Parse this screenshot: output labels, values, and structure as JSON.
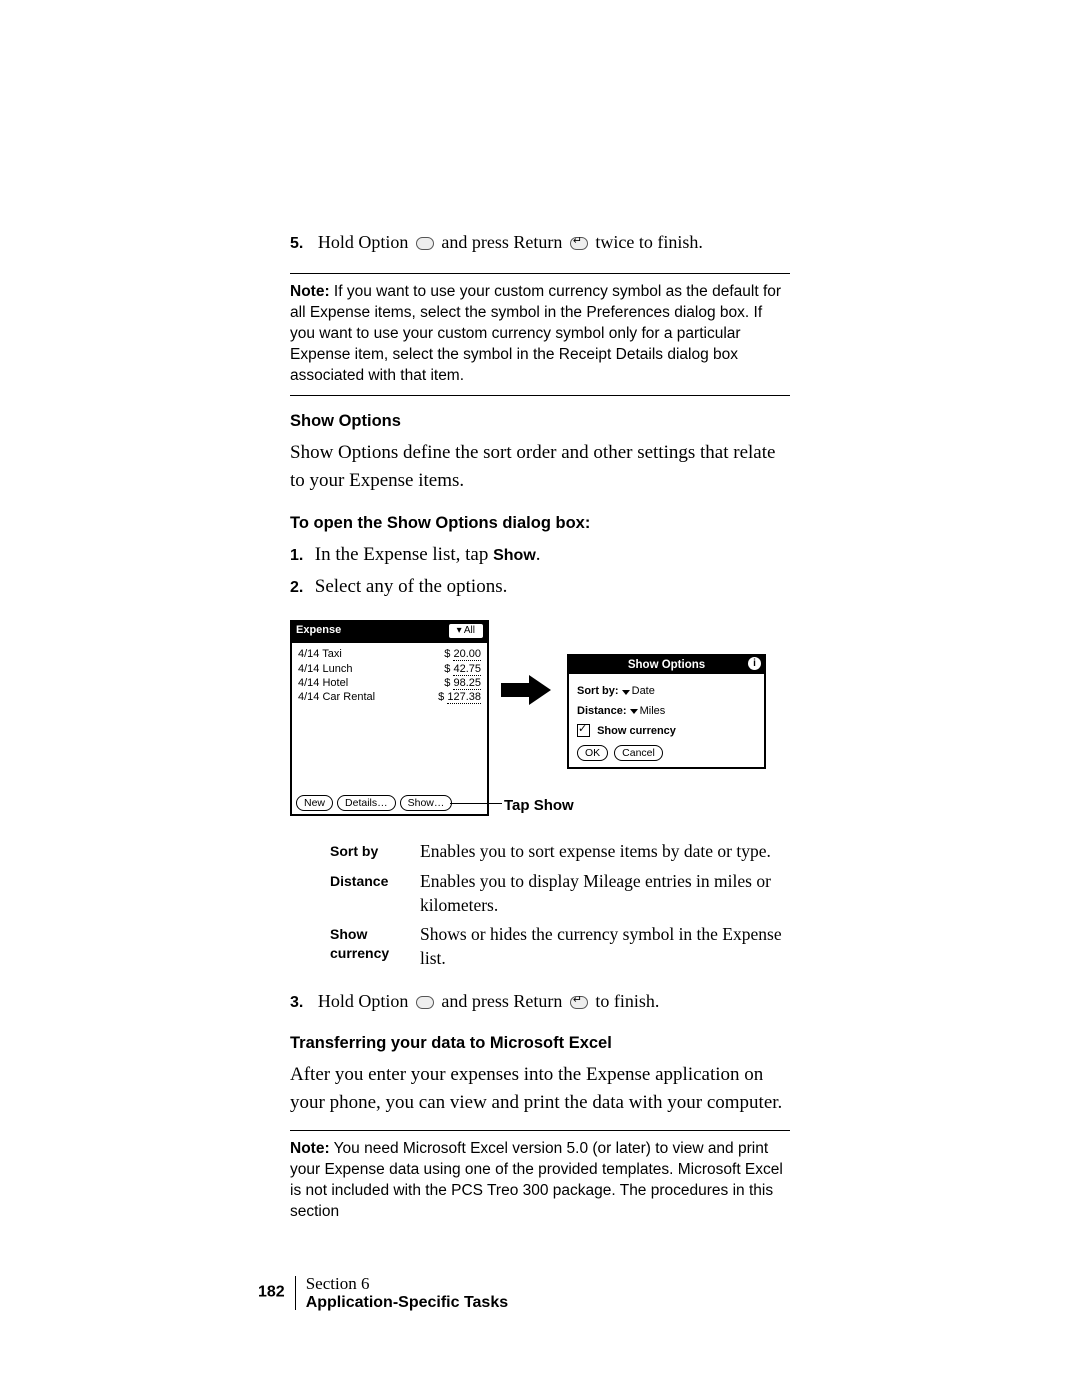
{
  "step5": {
    "num": "5.",
    "pre": "Hold Option ",
    "mid": " and press Return ",
    "post": " twice to finish."
  },
  "note1": {
    "label": "Note:",
    "text": " If you want to use your custom currency symbol as the default for all Expense items, select the symbol in the Preferences dialog box. If you want to use your custom currency symbol only for a particular Expense item, select the symbol in the Receipt Details dialog box associated with that item."
  },
  "sec1": {
    "heading": "Show Options",
    "body": "Show Options define the sort order and other settings that relate to your Expense items."
  },
  "sec2": {
    "heading": "To open the Show Options dialog box:",
    "step1_num": "1.",
    "step1_pre": "In the Expense list, tap ",
    "step1_bold": "Show",
    "step1_post": ".",
    "step2_num": "2.",
    "step2": "Select any of the options."
  },
  "palm": {
    "title": "Expense",
    "filter": "▾ All",
    "rows": [
      {
        "date": "4/14",
        "item": "Taxi",
        "cur": "$",
        "amt": "20.00"
      },
      {
        "date": "4/14",
        "item": "Lunch",
        "cur": "$",
        "amt": "42.75"
      },
      {
        "date": "4/14",
        "item": "Hotel",
        "cur": "$",
        "amt": "98.25"
      },
      {
        "date": "4/14",
        "item": "Car Rental",
        "cur": "$",
        "amt": "127.38"
      }
    ],
    "btn_new": "New",
    "btn_details": "Details…",
    "btn_show": "Show…"
  },
  "tap_show": "Tap Show",
  "dialog": {
    "title": "Show Options",
    "sortby_label": "Sort by:",
    "sortby_value": "Date",
    "distance_label": "Distance:",
    "distance_value": "Miles",
    "check_label": "Show currency",
    "ok": "OK",
    "cancel": "Cancel"
  },
  "defs": {
    "r1_term": "Sort by",
    "r1_desc": "Enables you to sort expense items by date or type.",
    "r2_term": "Distance",
    "r2_desc": "Enables you to display Mileage entries in miles or kilometers.",
    "r3_term": "Show currency",
    "r3_desc": "Shows or hides the currency symbol in the Expense list."
  },
  "step3": {
    "num": "3.",
    "pre": "Hold Option ",
    "mid": " and press Return ",
    "post": " to finish."
  },
  "sec3": {
    "heading": "Transferring your data to Microsoft Excel",
    "body": "After you enter your expenses into the Expense application on your phone, you can view and print the data with your computer."
  },
  "note2": {
    "label": "Note:",
    "text": " You need Microsoft Excel version 5.0 (or later) to view and print your Expense data using one of the provided templates. Microsoft Excel is not included with the PCS Treo 300 package. The procedures in this section"
  },
  "footer": {
    "section": "Section 6",
    "page": "182",
    "topic": "Application-Specific Tasks"
  }
}
